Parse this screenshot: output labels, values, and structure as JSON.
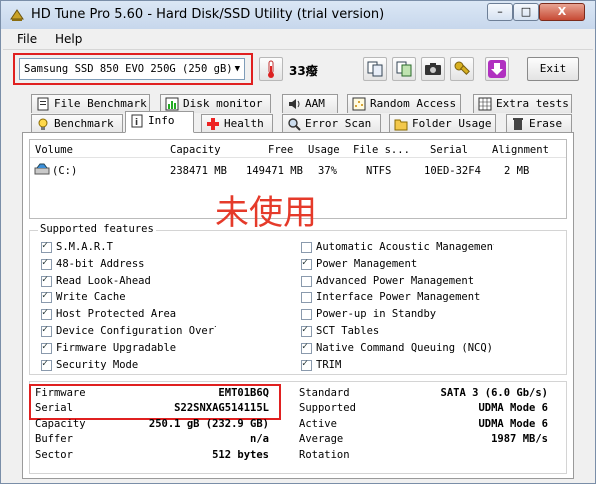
{
  "window": {
    "title": "HD Tune Pro 5.60 - Hard Disk/SSD Utility (trial version)",
    "minimize": "–",
    "maximize": "□",
    "close": "X"
  },
  "menu": {
    "file": "File",
    "help": "Help"
  },
  "toolbar": {
    "drive": "Samsung SSD 850 EVO 250G (250 gB)",
    "temperature": "33癈",
    "exit": "Exit"
  },
  "tabs_top": [
    "File Benchmark",
    "Disk monitor",
    "AAM",
    "Random Access",
    "Extra tests"
  ],
  "tabs_bottom": [
    "Benchmark",
    "Info",
    "Health",
    "Error Scan",
    "Folder Usage",
    "Erase"
  ],
  "volumes": {
    "headers": [
      "Volume",
      "Capacity",
      "Free",
      "Usage",
      "File s...",
      "Serial",
      "Alignment"
    ],
    "rows": [
      [
        "(C:)",
        "238471 MB",
        "149471 MB",
        "37%",
        "NTFS",
        "10ED-32F4",
        "2 MB"
      ]
    ]
  },
  "annotation": "未使用",
  "features": {
    "title": "Supported features",
    "left": [
      {
        "label": "S.M.A.R.T",
        "checked": true
      },
      {
        "label": "48-bit Address",
        "checked": true
      },
      {
        "label": "Read Look-Ahead",
        "checked": true
      },
      {
        "label": "Write Cache",
        "checked": true
      },
      {
        "label": "Host Protected Area",
        "checked": true
      },
      {
        "label": "Device Configuration Overlay",
        "checked": true
      },
      {
        "label": "Firmware Upgradable",
        "checked": true
      },
      {
        "label": "Security Mode",
        "checked": true
      }
    ],
    "right": [
      {
        "label": "Automatic Acoustic Management",
        "checked": false
      },
      {
        "label": "Power Management",
        "checked": true
      },
      {
        "label": "Advanced Power Management",
        "checked": false
      },
      {
        "label": "Interface Power Management",
        "checked": false
      },
      {
        "label": "Power-up in Standby",
        "checked": false
      },
      {
        "label": "SCT Tables",
        "checked": true
      },
      {
        "label": "Native Command Queuing (NCQ)",
        "checked": true
      },
      {
        "label": "TRIM",
        "checked": true
      }
    ]
  },
  "info": {
    "left": [
      {
        "label": "Firmware",
        "value": "EMT01B6Q"
      },
      {
        "label": "Serial",
        "value": "S22SNXAG514115L"
      },
      {
        "label": "Capacity",
        "value": "250.1 gB (232.9 GB)"
      },
      {
        "label": "Buffer",
        "value": "n/a"
      },
      {
        "label": "Sector",
        "value": "512 bytes"
      }
    ],
    "right": [
      {
        "label": "Standard",
        "value": "SATA 3 (6.0 Gb/s)"
      },
      {
        "label": "Supported",
        "value": "UDMA Mode 6"
      },
      {
        "label": "Active",
        "value": "UDMA Mode 6"
      },
      {
        "label": "Average",
        "value": "1987 MB/s"
      },
      {
        "label": "Rotation",
        "value": ""
      }
    ]
  }
}
